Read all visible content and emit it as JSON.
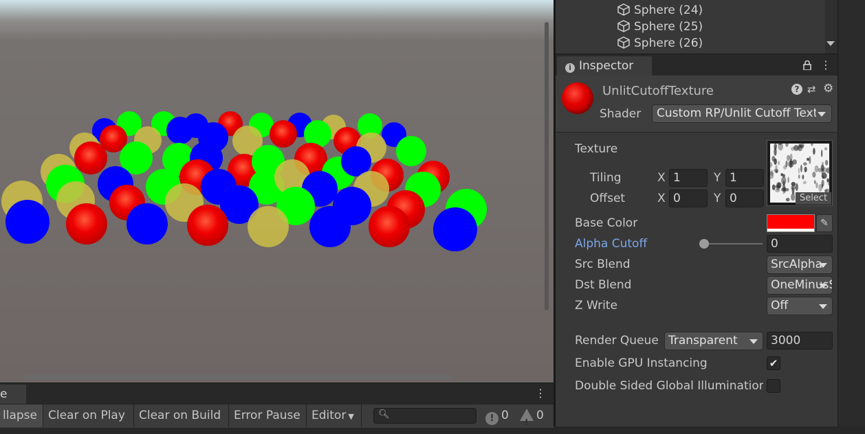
{
  "console": {
    "tab_label": "e",
    "buttons": [
      "llapse",
      "Clear on Play",
      "Clear on Build",
      "Error Pause",
      "Editor"
    ],
    "error_count": "0",
    "warning_count": "0",
    "menu_icon": "kebab-icon"
  },
  "hierarchy": {
    "items": [
      "Sphere (24)",
      "Sphere (25)",
      "Sphere (26)"
    ]
  },
  "inspector": {
    "tab_label": "Inspector",
    "material_name": "UnlitCutoffTexture",
    "shader_label": "Shader",
    "shader_value": "Custom RP/Unlit Cutoff Texture",
    "texture_label": "Texture",
    "tiling_label": "Tiling",
    "offset_label": "Offset",
    "tiling_x": "1",
    "tiling_y": "1",
    "offset_x": "0",
    "offset_y": "0",
    "x_label": "X",
    "y_label": "Y",
    "texture_select": "Select",
    "base_color_label": "Base Color",
    "base_color": "#ff0000",
    "alpha_cutoff_label": "Alpha Cutoff",
    "alpha_cutoff_value": "0",
    "src_blend_label": "Src Blend",
    "src_blend_value": "SrcAlpha",
    "dst_blend_label": "Dst Blend",
    "dst_blend_value": "OneMinusSrcAlpha",
    "zwrite_label": "Z Write",
    "zwrite_value": "Off",
    "render_queue_label": "Render Queue",
    "render_queue_mode": "Transparent",
    "render_queue_value": "3000",
    "gpu_instancing_label": "Enable GPU Instancing",
    "gpu_instancing_checked": true,
    "double_sided_gi_label": "Double Sided Global Illumination",
    "double_sided_gi_checked": false
  }
}
